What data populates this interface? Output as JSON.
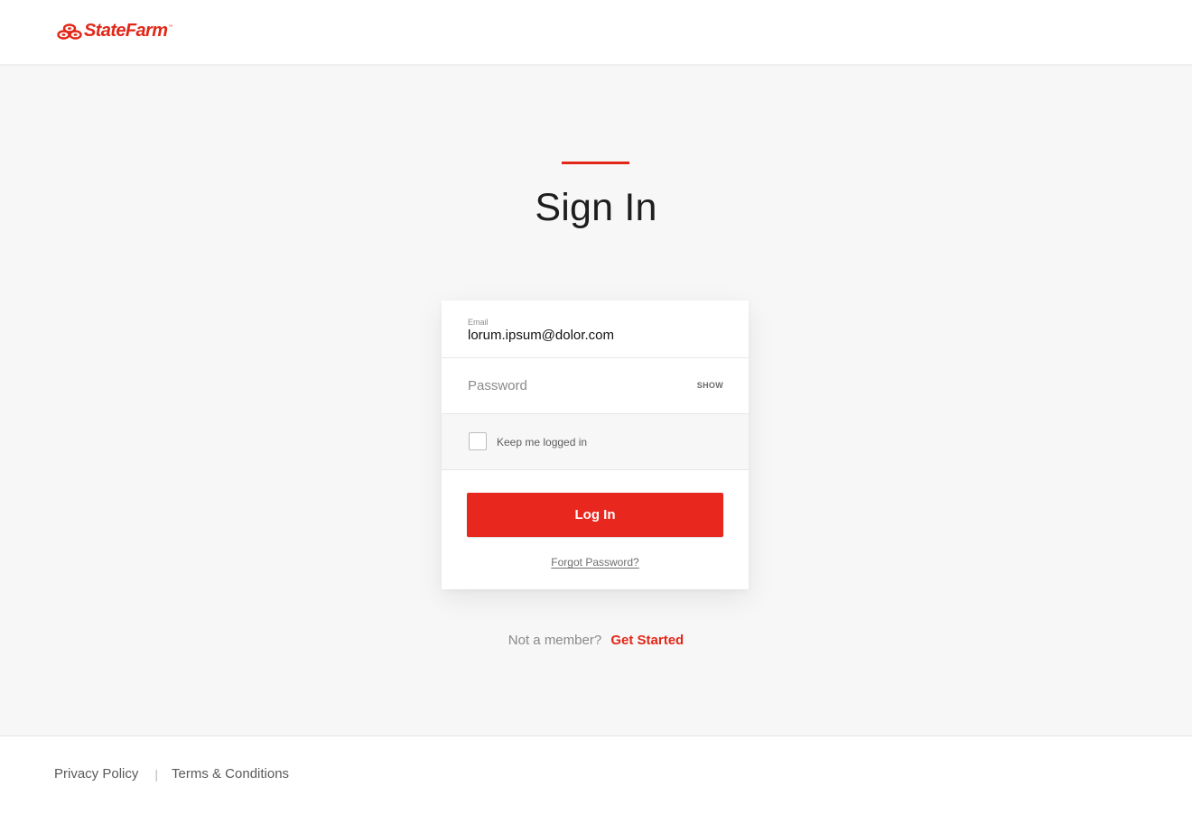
{
  "header": {
    "logo_text": "StateFarm",
    "logo_tm": "™",
    "logo_icon": "state-farm-three-ovals-icon"
  },
  "colors": {
    "brand_red": "#e22718",
    "button_red": "#e8281e",
    "background": "#f7f7f7"
  },
  "page": {
    "title": "Sign In"
  },
  "form": {
    "email_label": "Email",
    "email_value": "lorum.ipsum@dolor.com",
    "password_placeholder": "Password",
    "password_value": "",
    "show_label": "SHOW",
    "remember_label": "Keep me logged in",
    "remember_checked": false,
    "login_label": "Log In",
    "forgot_label": "Forgot Password?"
  },
  "signup": {
    "prompt": "Not a member?",
    "link_label": "Get Started"
  },
  "footer": {
    "privacy_label": "Privacy Policy",
    "separator": "|",
    "terms_label": "Terms & Conditions"
  }
}
